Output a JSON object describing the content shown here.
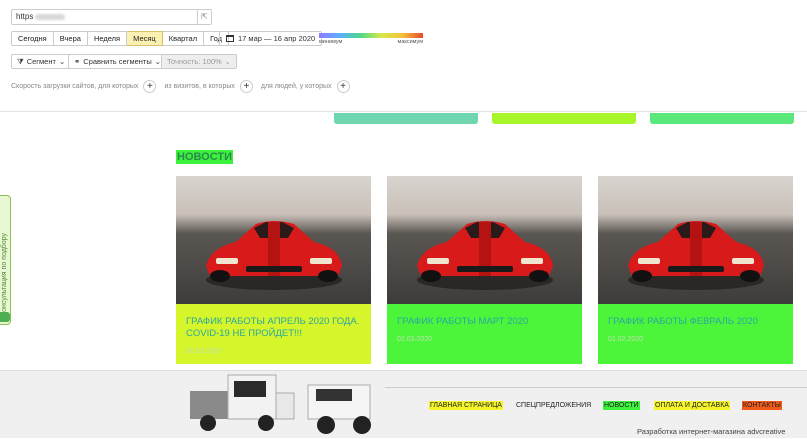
{
  "toolbar": {
    "url_prefix": "https",
    "periods": [
      "Сегодня",
      "Вчера",
      "Неделя",
      "Месяц",
      "Квартал",
      "Год"
    ],
    "active_period": "Месяц",
    "date_range": "17 мар — 16 апр 2020",
    "scale_min": "минимум",
    "scale_max": "максимум",
    "segment_label": "Сегмент",
    "compare_label": "Сравнить сегменты",
    "accuracy_label": "Точность: 100%",
    "filter_1": "Скорость загрузки сайтов, для которых",
    "filter_2": "из визитов, в которых",
    "filter_3": "для людей, у которых"
  },
  "colors": {
    "strip_1": "#6fd6b0",
    "strip_2": "#a8f52a",
    "strip_3": "#5ae87a",
    "card_yellow": "#d6f52a",
    "card_green": "#4cf53a",
    "nav_yellow": "#f5f52a",
    "nav_green": "#3cf23c",
    "nav_orange": "#f25a1a"
  },
  "side_tab": "Консультация по подбору",
  "news": {
    "title": "НОВОСТИ",
    "cards": [
      {
        "title": "ГРАФИК РАБОТЫ АПРЕЛЬ 2020 ГОДА. COVID-19 НЕ ПРОЙДЕТ!!!",
        "date": "30.03.2020"
      },
      {
        "title": "ГРАФИК РАБОТЫ МАРТ 2020",
        "date": "02.03.2020"
      },
      {
        "title": "ГРАФИК РАБОТЫ ФЕВРАЛЬ 2020",
        "date": "01.02.2020"
      }
    ]
  },
  "footer": {
    "nav": [
      "ГЛАВНАЯ СТРАНИЦА",
      "СПЕЦПРЕДЛОЖЕНИЯ",
      "НОВОСТИ",
      "ОПЛАТА И ДОСТАВКА",
      "КОНТАКТЫ"
    ],
    "copyright": "Разработка интернет-магазина advcreative"
  }
}
